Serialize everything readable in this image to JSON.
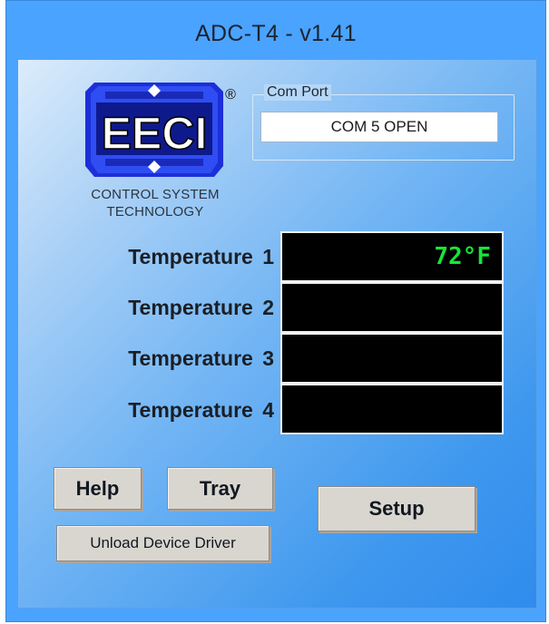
{
  "window": {
    "title": "ADC-T4 - v1.41"
  },
  "logo": {
    "brand_text": "EECI",
    "registered_mark": "®",
    "caption_line1": "CONTROL SYSTEM",
    "caption_line2": "TECHNOLOGY"
  },
  "com_port": {
    "legend": "Com Port",
    "status": "COM 5 OPEN"
  },
  "temperatures": [
    {
      "label": "Temperature  1",
      "value": "72°F"
    },
    {
      "label": "Temperature  2",
      "value": ""
    },
    {
      "label": "Temperature  3",
      "value": ""
    },
    {
      "label": "Temperature  4",
      "value": ""
    }
  ],
  "buttons": {
    "help": "Help",
    "tray": "Tray",
    "setup": "Setup",
    "unload": "Unload Device Driver"
  },
  "colors": {
    "titlebar": "#4aa3ff",
    "display_bg": "#000000",
    "display_text": "#17e43a",
    "logo_blue": "#1c2fd9",
    "button_face": "#d9d6d0"
  }
}
